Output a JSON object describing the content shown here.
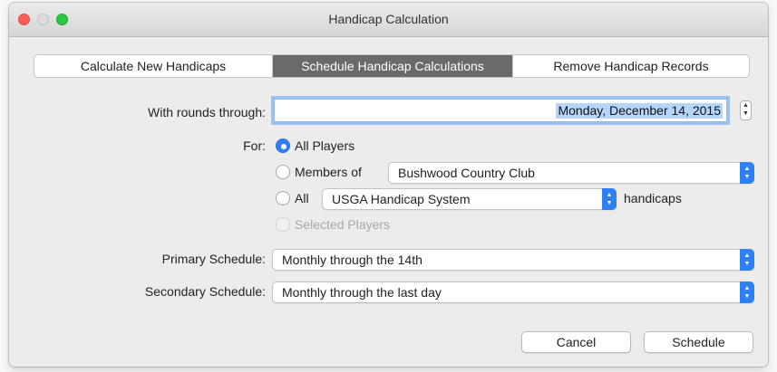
{
  "window": {
    "title": "Handicap Calculation"
  },
  "tabs": [
    {
      "label": "Calculate New Handicaps",
      "selected": false
    },
    {
      "label": "Schedule Handicap Calculations",
      "selected": true
    },
    {
      "label": "Remove Handicap Records",
      "selected": false
    }
  ],
  "form": {
    "rounds_label": "With rounds through:",
    "rounds_value": "Monday, December 14, 2015",
    "for_label": "For:",
    "options": {
      "all_players": "All Players",
      "members_of": "Members of",
      "members_club": "Bushwood Country Club",
      "all": "All",
      "system": "USGA Handicap System",
      "handicaps": "handicaps",
      "selected_players": "Selected Players"
    },
    "selected_option": "all_players",
    "primary_label": "Primary Schedule:",
    "primary_value": "Monthly through the 14th",
    "secondary_label": "Secondary Schedule:",
    "secondary_value": "Monthly through the last day"
  },
  "buttons": {
    "cancel": "Cancel",
    "schedule": "Schedule"
  },
  "colors": {
    "accent": "#2f7ff5",
    "selected_tab": "#6a6a6a",
    "focus_ring": "#9cc2f2",
    "close": "#fc5f57",
    "maximize": "#28c940"
  }
}
